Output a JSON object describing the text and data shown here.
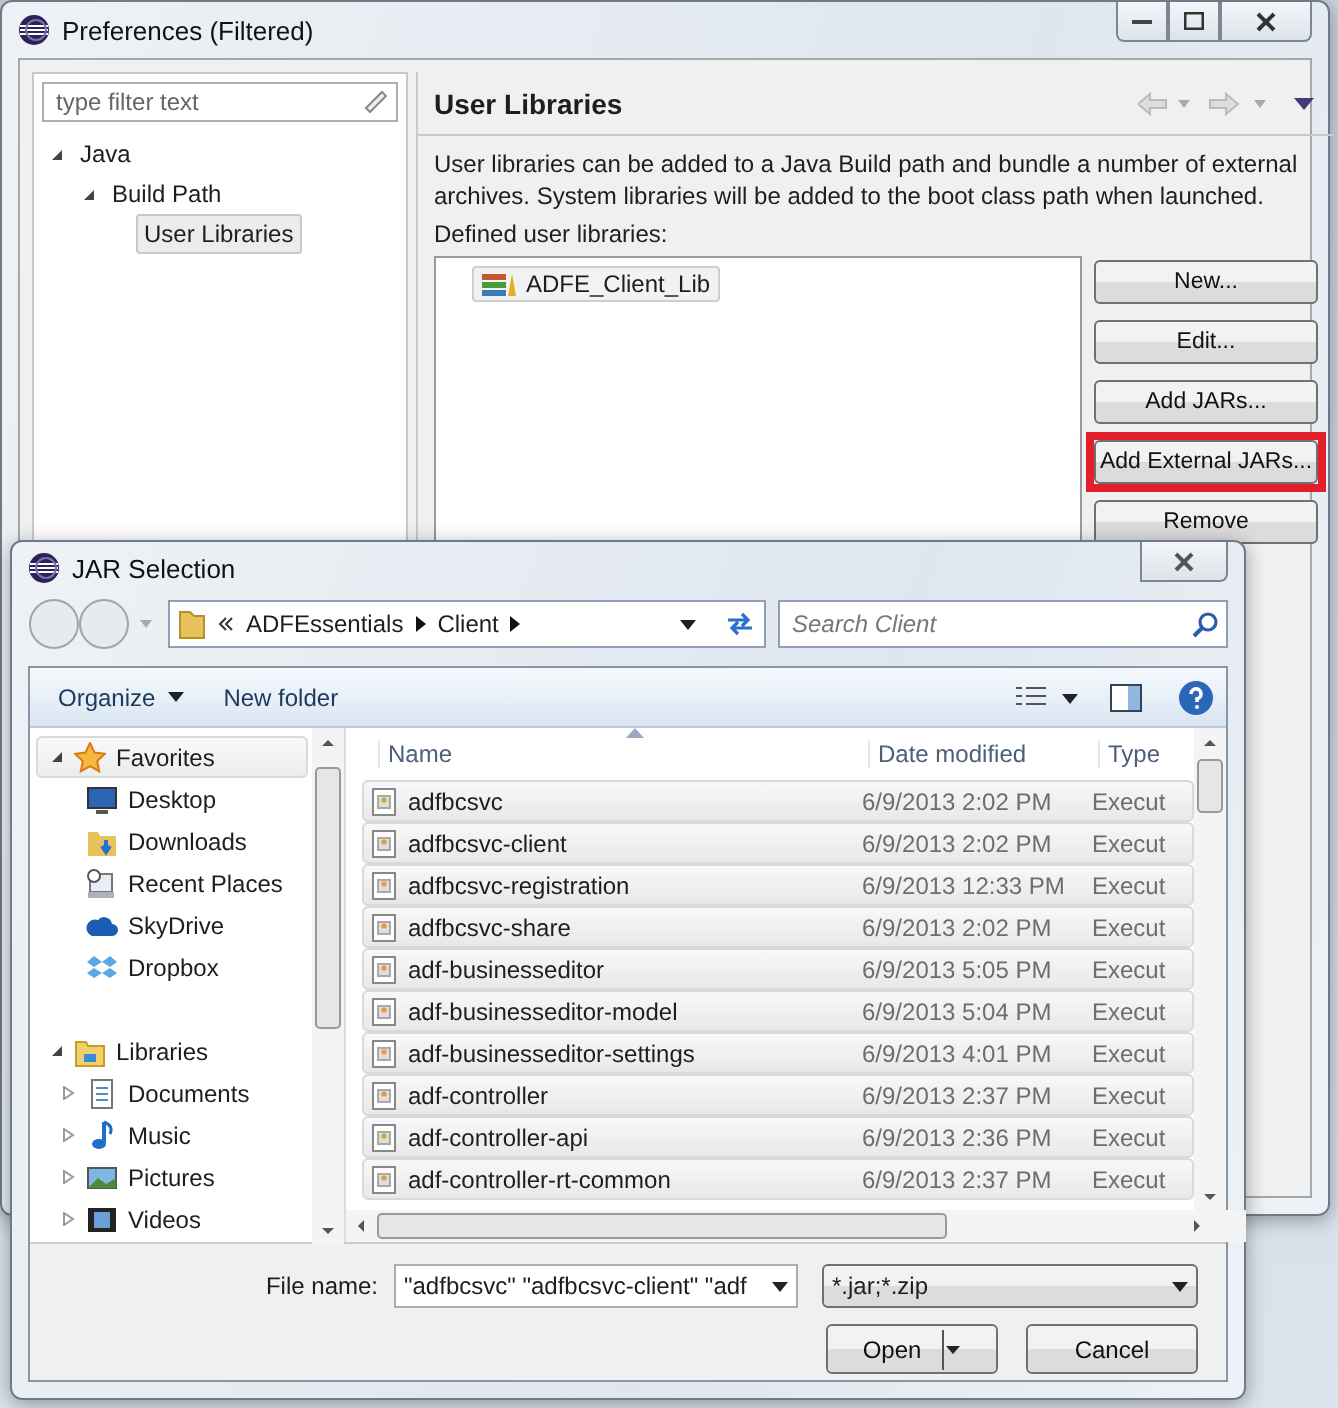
{
  "preferences": {
    "title": "Preferences (Filtered)",
    "filter": {
      "placeholder": "type filter text"
    },
    "tree": [
      {
        "label": "Java",
        "expanded": true,
        "selected": false,
        "children": [
          {
            "label": "Build Path",
            "expanded": true,
            "selected": false,
            "children": [
              {
                "label": "User Libraries",
                "selected": true
              }
            ]
          }
        ]
      }
    ],
    "page_title": "User Libraries",
    "description": "User libraries can be added to a Java Build path and bundle a number of external archives. System libraries will be added to the boot class path when launched.",
    "list_label": "Defined user libraries:",
    "libraries": [
      {
        "label": "ADFE_Client_Lib",
        "selected": true
      }
    ],
    "buttons": [
      {
        "label": "New...",
        "highlighted": false
      },
      {
        "label": "Edit...",
        "highlighted": false
      },
      {
        "label": "Add JARs...",
        "highlighted": false
      },
      {
        "label": "Add External JARs...",
        "highlighted": true
      },
      {
        "label": "Remove",
        "highlighted": false
      }
    ]
  },
  "jar_dialog": {
    "title": "JAR Selection",
    "breadcrumb": [
      "ADFEssentials",
      "Client"
    ],
    "search": {
      "placeholder": "Search Client"
    },
    "toolbar": [
      {
        "label": "Organize",
        "menu": true
      },
      {
        "label": "New folder",
        "menu": false
      }
    ],
    "nav": [
      {
        "label": "Favorites",
        "kind": "favorites",
        "selected": true,
        "expanded": true,
        "children": [
          {
            "label": "Desktop",
            "kind": "desktop"
          },
          {
            "label": "Downloads",
            "kind": "downloads"
          },
          {
            "label": "Recent Places",
            "kind": "recent"
          },
          {
            "label": "SkyDrive",
            "kind": "cloud"
          },
          {
            "label": "Dropbox",
            "kind": "dropbox"
          }
        ]
      },
      {
        "label": "Libraries",
        "kind": "libraries",
        "selected": false,
        "expanded": true,
        "children": [
          {
            "label": "Documents",
            "kind": "documents",
            "expanded": false
          },
          {
            "label": "Music",
            "kind": "music",
            "expanded": false
          },
          {
            "label": "Pictures",
            "kind": "pictures",
            "expanded": false
          },
          {
            "label": "Videos",
            "kind": "videos",
            "expanded": false
          }
        ]
      }
    ],
    "columns": [
      "Name",
      "Date modified",
      "Type"
    ],
    "files": [
      {
        "name": "adfbcsvc",
        "date": "6/9/2013 2:02 PM",
        "type": "Execut",
        "selected": true
      },
      {
        "name": "adfbcsvc-client",
        "date": "6/9/2013 2:02 PM",
        "type": "Execut",
        "selected": true
      },
      {
        "name": "adfbcsvc-registration",
        "date": "6/9/2013 12:33 PM",
        "type": "Execut",
        "selected": true
      },
      {
        "name": "adfbcsvc-share",
        "date": "6/9/2013 2:02 PM",
        "type": "Execut",
        "selected": true
      },
      {
        "name": "adf-businesseditor",
        "date": "6/9/2013 5:05 PM",
        "type": "Execut",
        "selected": true
      },
      {
        "name": "adf-businesseditor-model",
        "date": "6/9/2013 5:04 PM",
        "type": "Execut",
        "selected": true
      },
      {
        "name": "adf-businesseditor-settings",
        "date": "6/9/2013 4:01 PM",
        "type": "Execut",
        "selected": true
      },
      {
        "name": "adf-controller",
        "date": "6/9/2013 2:37 PM",
        "type": "Execut",
        "selected": true
      },
      {
        "name": "adf-controller-api",
        "date": "6/9/2013 2:36 PM",
        "type": "Execut",
        "selected": true
      },
      {
        "name": "adf-controller-rt-common",
        "date": "6/9/2013 2:37 PM",
        "type": "Execut",
        "selected": true
      }
    ],
    "file_name_label": "File name:",
    "file_name": "\"adfbcsvc\" \"adfbcsvc-client\" \"adf",
    "file_type": "*.jar;*.zip",
    "buttons": [
      {
        "label": "Open",
        "split": true
      },
      {
        "label": "Cancel",
        "split": false
      }
    ]
  }
}
